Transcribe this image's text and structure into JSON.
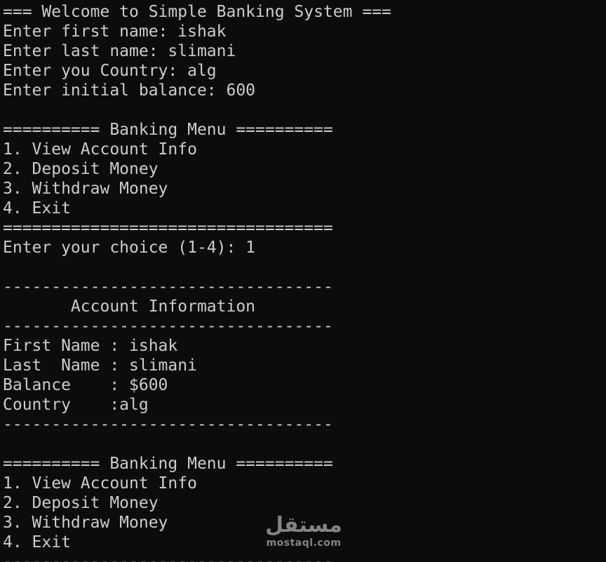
{
  "terminal": {
    "lines": [
      "=== Welcome to Simple Banking System ===",
      "Enter first name: ishak",
      "Enter last name: slimani",
      "Enter you Country: alg",
      "Enter initial balance: 600",
      "",
      "========== Banking Menu ==========",
      "1. View Account Info",
      "2. Deposit Money",
      "3. Withdraw Money",
      "4. Exit",
      "==================================",
      "Enter your choice (1-4): 1",
      "",
      "----------------------------------",
      "       Account Information",
      "----------------------------------",
      "First Name : ishak",
      "Last  Name : slimani",
      "Balance    : $600",
      "Country    :alg",
      "----------------------------------",
      "",
      "========== Banking Menu ==========",
      "1. View Account Info",
      "2. Deposit Money",
      "3. Withdraw Money",
      "4. Exit",
      "----------------------------------"
    ]
  },
  "watermark": {
    "logo_text": "مستقل",
    "site": "mostaql.com"
  }
}
